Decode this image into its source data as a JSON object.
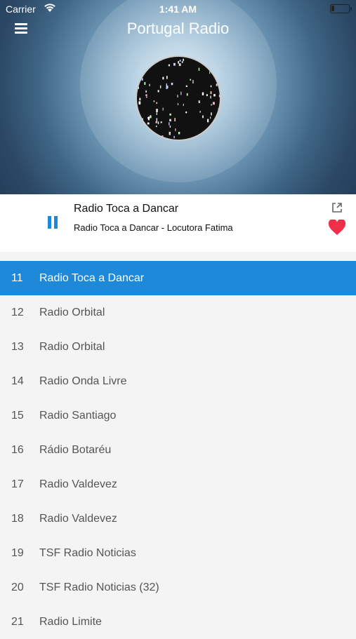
{
  "status_bar": {
    "carrier": "Carrier",
    "time": "1:41 AM"
  },
  "header": {
    "title": "Portugal Radio"
  },
  "now_playing": {
    "station": "Radio Toca a Dancar",
    "track": "Radio Toca a Dancar - Locutora Fatima"
  },
  "colors": {
    "accent": "#1e88d9",
    "favorite": "#f0304a"
  },
  "stations": [
    {
      "number": "11",
      "name": "Radio Toca a Dancar",
      "active": true
    },
    {
      "number": "12",
      "name": "Radio Orbital"
    },
    {
      "number": "13",
      "name": "Radio Orbital"
    },
    {
      "number": "14",
      "name": "Radio Onda Livre"
    },
    {
      "number": "15",
      "name": "Radio Santiago"
    },
    {
      "number": "16",
      "name": "Rádio Botaréu"
    },
    {
      "number": "17",
      "name": "Radio Valdevez"
    },
    {
      "number": "18",
      "name": "Radio Valdevez"
    },
    {
      "number": "19",
      "name": "TSF Radio Noticias"
    },
    {
      "number": "20",
      "name": "TSF Radio Noticias (32)"
    },
    {
      "number": "21",
      "name": "Radio Limite"
    }
  ]
}
